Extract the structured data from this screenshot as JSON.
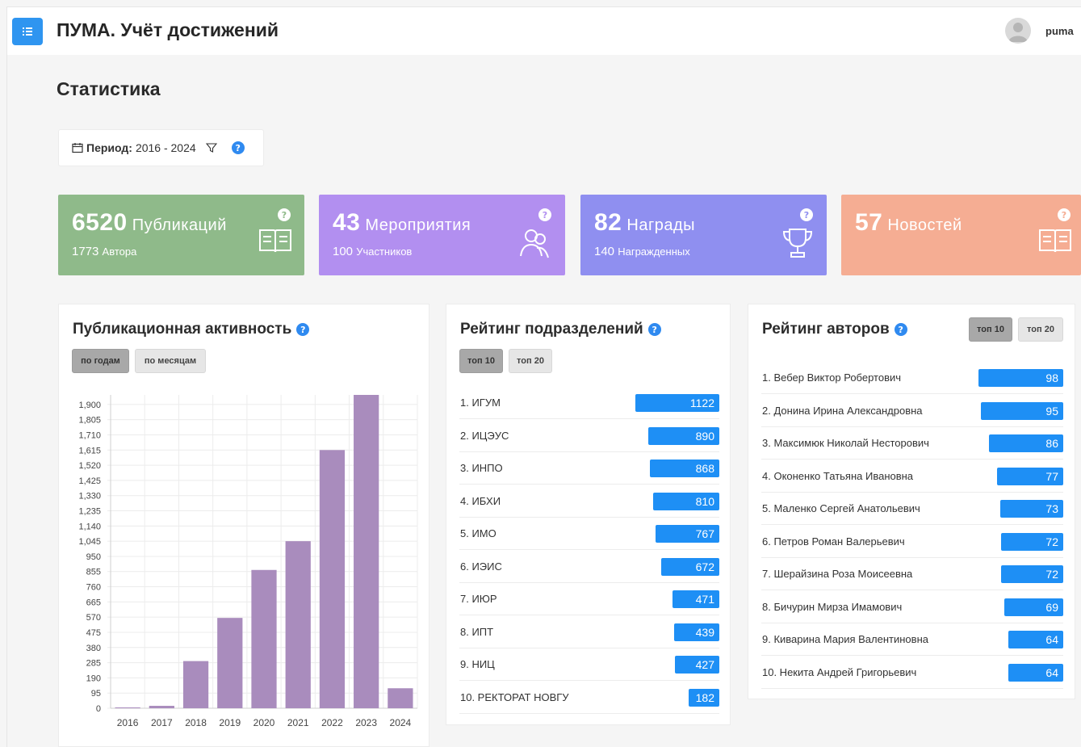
{
  "header": {
    "app_title": "ПУМА. Учёт достижений",
    "username": "puma"
  },
  "page": {
    "title": "Статистика",
    "period_label": "Период:",
    "period_value": "2016 - 2024"
  },
  "stat_cards": [
    {
      "value": "6520",
      "label": "Публикаций",
      "sub_value": "1773",
      "sub_label": "Автора",
      "color": "#8fba8a",
      "icon": "open-book-icon"
    },
    {
      "value": "43",
      "label": "Мероприятия",
      "sub_value": "100",
      "sub_label": "Участников",
      "color": "#b28ff0",
      "icon": "people-icon"
    },
    {
      "value": "82",
      "label": "Награды",
      "sub_value": "140",
      "sub_label": "Награжденных",
      "color": "#8f8ff0",
      "icon": "trophy-icon"
    },
    {
      "value": "57",
      "label": "Новостей",
      "sub_value": "",
      "sub_label": "",
      "color": "#f5ad93",
      "icon": "open-book-icon"
    }
  ],
  "pub_activity": {
    "title": "Публикационная активность",
    "buttons": [
      "по годам",
      "по месяцам"
    ],
    "active_button": 0
  },
  "chart_data": {
    "type": "bar",
    "categories": [
      "2016",
      "2017",
      "2018",
      "2019",
      "2020",
      "2021",
      "2022",
      "2023",
      "2024"
    ],
    "values": [
      5,
      15,
      295,
      565,
      865,
      1045,
      1615,
      1960,
      125
    ],
    "ylim": [
      0,
      1960
    ],
    "yticks": [
      0,
      95,
      190,
      285,
      380,
      475,
      570,
      665,
      760,
      855,
      950,
      1045,
      1140,
      1235,
      1330,
      1425,
      1520,
      1615,
      1710,
      1805,
      1900
    ],
    "ytick_labels": [
      "0",
      "95",
      "190",
      "285",
      "380",
      "475",
      "570",
      "665",
      "760",
      "855",
      "950",
      "1,045",
      "1,140",
      "1,235",
      "1,330",
      "1,425",
      "1,520",
      "1,615",
      "1,710",
      "1,805",
      "1,900"
    ],
    "bar_color": "#a98cbd",
    "grid": true
  },
  "dept_rating": {
    "title": "Рейтинг подразделений",
    "buttons": [
      "топ 10",
      "топ 20"
    ],
    "active_button": 0,
    "rows": [
      {
        "name": "1. ИГУМ",
        "value": 1122
      },
      {
        "name": "2. ИЦЭУС",
        "value": 890
      },
      {
        "name": "3. ИНПО",
        "value": 868
      },
      {
        "name": "4. ИБХИ",
        "value": 810
      },
      {
        "name": "5. ИМО",
        "value": 767
      },
      {
        "name": "6. ИЭИС",
        "value": 672
      },
      {
        "name": "7. ИЮР",
        "value": 471
      },
      {
        "name": "8. ИПТ",
        "value": 439
      },
      {
        "name": "9. НИЦ",
        "value": 427
      },
      {
        "name": "10. РЕКТОРАТ НОВГУ",
        "value": 182
      }
    ]
  },
  "author_rating": {
    "title": "Рейтинг авторов",
    "buttons": [
      "топ 10",
      "топ 20"
    ],
    "active_button": 0,
    "rows": [
      {
        "name": "1. Вебер Виктор Робертович",
        "value": 98
      },
      {
        "name": "2. Донина Ирина Александровна",
        "value": 95
      },
      {
        "name": "3. Максимюк Николай Несторович",
        "value": 86
      },
      {
        "name": "4. Оконенко Татьяна Ивановна",
        "value": 77
      },
      {
        "name": "5. Маленко Сергей Анатольевич",
        "value": 73
      },
      {
        "name": "6. Петров Роман Валерьевич",
        "value": 72
      },
      {
        "name": "7. Шерайзина Роза Моисеевна",
        "value": 72
      },
      {
        "name": "8. Бичурин Мирза Имамович",
        "value": 69
      },
      {
        "name": "9. Киварина Мария Валентиновна",
        "value": 64
      },
      {
        "name": "10. Некита Андрей Григорьевич",
        "value": 64
      }
    ]
  },
  "help_mark": "?",
  "colors": {
    "accent": "#1e8ff5",
    "help": "#2f8af0"
  }
}
